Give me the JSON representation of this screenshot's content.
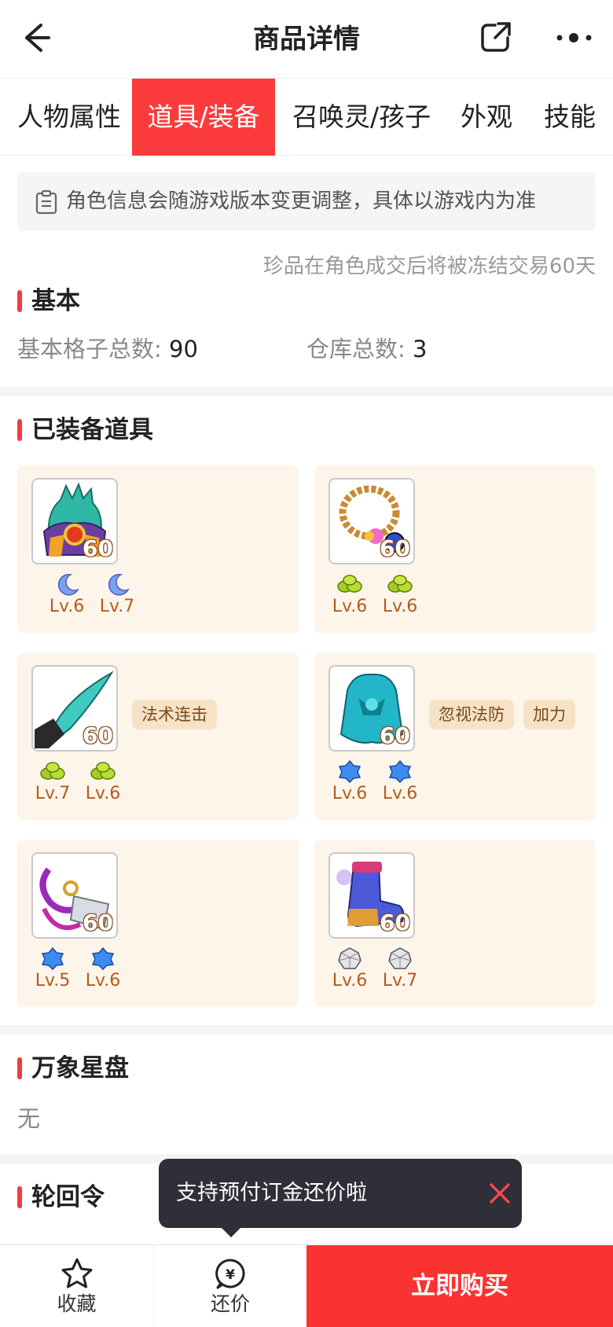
{
  "header": {
    "title": "商品详情",
    "back_icon": "back-arrow-icon",
    "share_icon": "share-icon",
    "more_icon": "more-dots-icon"
  },
  "tabs": [
    {
      "label": "人物属性",
      "active": false
    },
    {
      "label": "道具/装备",
      "active": true
    },
    {
      "label": "召唤灵/孩子",
      "active": false
    },
    {
      "label": "外观",
      "active": false
    },
    {
      "label": "技能",
      "active": false
    }
  ],
  "notice": {
    "icon": "clipboard-icon",
    "text": "角色信息会随游戏版本变更调整，具体以游戏内为准"
  },
  "freeze_note": "珍品在角色成交后将被冻结交易60天",
  "basic": {
    "title": "基本",
    "slots_label": "基本格子总数:",
    "slots_value": "90",
    "warehouse_label": "仓库总数:",
    "warehouse_value": "3"
  },
  "equipped": {
    "title": "已装备道具",
    "items": [
      {
        "name": "helmet",
        "level": "60",
        "gems": [
          {
            "type": "moon-gem",
            "level": "Lv.6"
          },
          {
            "type": "moon-gem",
            "level": "Lv.7"
          }
        ],
        "tags": []
      },
      {
        "name": "necklace",
        "level": "60",
        "gems": [
          {
            "type": "green-gem",
            "level": "Lv.6"
          },
          {
            "type": "green-gem",
            "level": "Lv.6"
          }
        ],
        "tags": []
      },
      {
        "name": "weapon",
        "level": "60",
        "gems": [
          {
            "type": "green-gem",
            "level": "Lv.7"
          },
          {
            "type": "green-gem",
            "level": "Lv.6"
          }
        ],
        "tags": [
          "法术连击"
        ]
      },
      {
        "name": "armor",
        "level": "60",
        "gems": [
          {
            "type": "blue-gem",
            "level": "Lv.6"
          },
          {
            "type": "blue-gem",
            "level": "Lv.6"
          }
        ],
        "tags": [
          "忽视法防",
          "加力"
        ]
      },
      {
        "name": "belt",
        "level": "60",
        "gems": [
          {
            "type": "blue-gem",
            "level": "Lv.5"
          },
          {
            "type": "blue-gem",
            "level": "Lv.6"
          }
        ],
        "tags": []
      },
      {
        "name": "boots",
        "level": "60",
        "gems": [
          {
            "type": "silver-gem",
            "level": "Lv.6"
          },
          {
            "type": "silver-gem",
            "level": "Lv.7"
          }
        ],
        "tags": []
      }
    ]
  },
  "star_disk": {
    "title": "万象星盘",
    "value": "无"
  },
  "reincarnation": {
    "title": "轮回令"
  },
  "toast": {
    "text": "支持预付订金还价啦",
    "close_icon": "close-icon"
  },
  "bottom": {
    "favorite_label": "收藏",
    "bargain_label": "还价",
    "buy_label": "立即购买"
  },
  "colors": {
    "accent": "#fb3b3b",
    "card_bg": "#fef5ea",
    "tag_bg": "#f6e2c6",
    "gem_level": "#b35a1f"
  }
}
